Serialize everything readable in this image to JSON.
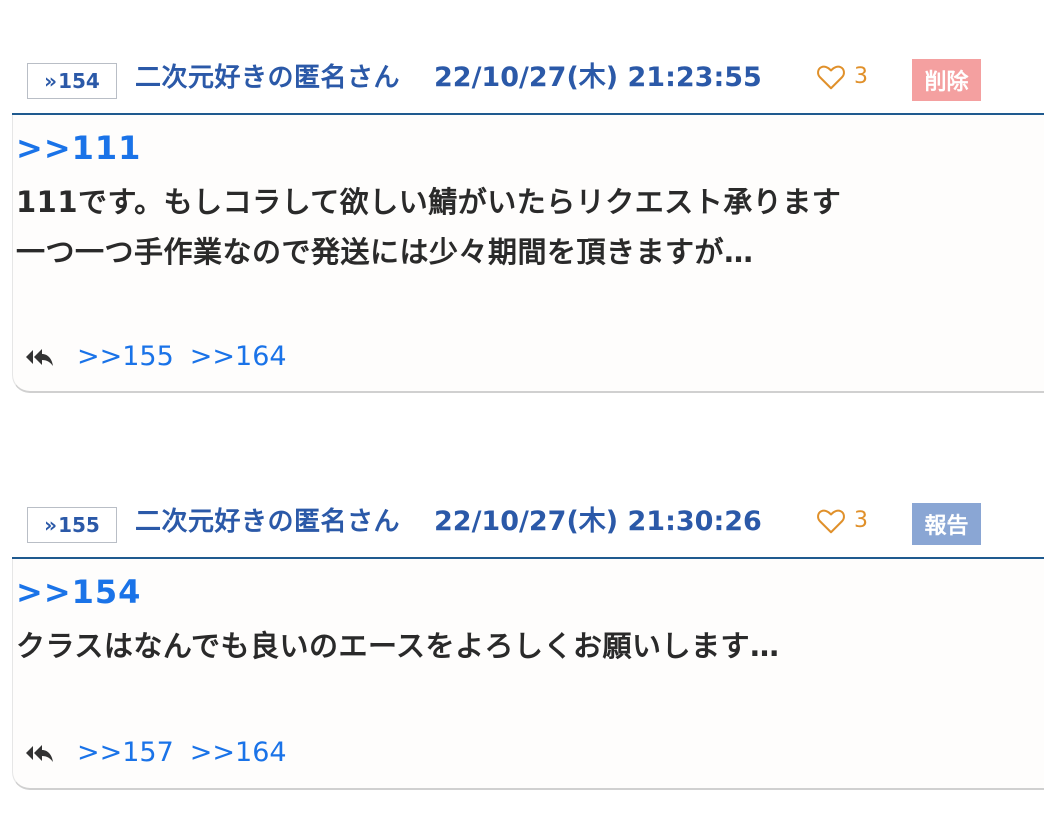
{
  "posts": [
    {
      "number": "154",
      "author": "二次元好きの匿名さん",
      "date": "22/10/27(木) 21:23:55",
      "likes": "3",
      "action": "削除",
      "anchor": ">>111",
      "lines": [
        "111です。もしコラして欲しい鯖がいたらリクエスト承ります",
        "一つ一つ手作業なので発送には少々期間を頂きますが…"
      ],
      "replies": [
        ">>155",
        ">>164"
      ]
    },
    {
      "number": "155",
      "author": "二次元好きの匿名さん",
      "date": "22/10/27(木) 21:30:26",
      "likes": "3",
      "action": "報告",
      "anchor": ">>154",
      "lines": [
        "クラスはなんでも良いのエースをよろしくお願いします…"
      ],
      "replies": [
        ">>157",
        ">>164"
      ]
    }
  ],
  "icons": {
    "res_arrow": "double-chevron-right-icon",
    "like": "heart-outline-icon",
    "reply": "reply-all-icon"
  },
  "colors": {
    "accent": "#2b59a8",
    "link": "#1a73e8",
    "like": "#e0902a",
    "delete_tag": "#f4a0a0",
    "report_tag": "#8aa6d4"
  }
}
